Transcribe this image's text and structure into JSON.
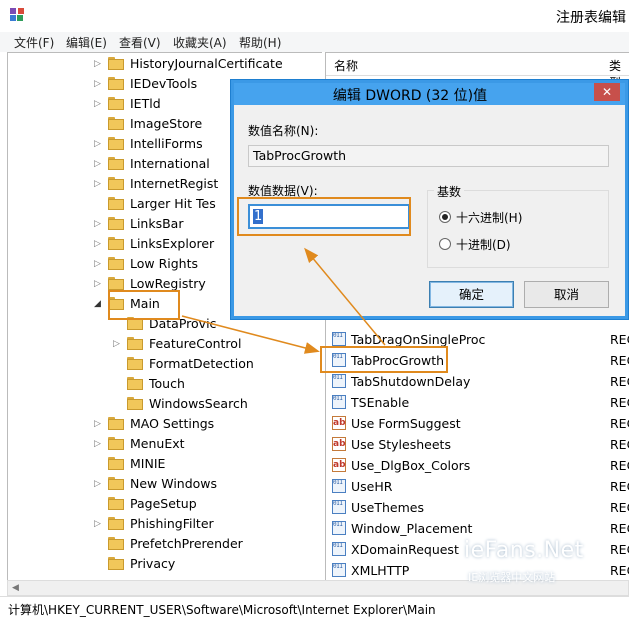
{
  "window": {
    "title": "注册表编辑",
    "icon": "regedit-icon"
  },
  "menubar": {
    "items": [
      "文件(F)",
      "编辑(E)",
      "查看(V)",
      "收藏夹(A)",
      "帮助(H)"
    ]
  },
  "tree": {
    "items": [
      {
        "label": "HistoryJournalCertificate",
        "level": 1,
        "expander": "collapsed"
      },
      {
        "label": "IEDevTools",
        "level": 1,
        "expander": "collapsed"
      },
      {
        "label": "IETld",
        "level": 1,
        "expander": "collapsed"
      },
      {
        "label": "ImageStore",
        "level": 1,
        "expander": "none"
      },
      {
        "label": "IntelliForms",
        "level": 1,
        "expander": "collapsed"
      },
      {
        "label": "International",
        "level": 1,
        "expander": "collapsed"
      },
      {
        "label": "InternetRegist",
        "level": 1,
        "expander": "collapsed"
      },
      {
        "label": "Larger Hit Tes",
        "level": 1,
        "expander": "none"
      },
      {
        "label": "LinksBar",
        "level": 1,
        "expander": "collapsed"
      },
      {
        "label": "LinksExplorer",
        "level": 1,
        "expander": "collapsed"
      },
      {
        "label": "Low Rights",
        "level": 1,
        "expander": "collapsed"
      },
      {
        "label": "LowRegistry",
        "level": 1,
        "expander": "collapsed"
      },
      {
        "label": "Main",
        "level": 1,
        "expander": "expanded"
      },
      {
        "label": "DataProvic",
        "level": 2,
        "expander": "none"
      },
      {
        "label": "FeatureControl",
        "level": 2,
        "expander": "collapsed"
      },
      {
        "label": "FormatDetection",
        "level": 2,
        "expander": "none"
      },
      {
        "label": "Touch",
        "level": 2,
        "expander": "none"
      },
      {
        "label": "WindowsSearch",
        "level": 2,
        "expander": "none"
      },
      {
        "label": "MAO Settings",
        "level": 1,
        "expander": "collapsed"
      },
      {
        "label": "MenuExt",
        "level": 1,
        "expander": "collapsed"
      },
      {
        "label": "MINIE",
        "level": 1,
        "expander": "none"
      },
      {
        "label": "New Windows",
        "level": 1,
        "expander": "collapsed"
      },
      {
        "label": "PageSetup",
        "level": 1,
        "expander": "none"
      },
      {
        "label": "PhishingFilter",
        "level": 1,
        "expander": "collapsed"
      },
      {
        "label": "PrefetchPrerender",
        "level": 1,
        "expander": "none"
      },
      {
        "label": "Privacy",
        "level": 1,
        "expander": "none"
      }
    ]
  },
  "list": {
    "headers": {
      "name": "名称",
      "type": "类型"
    },
    "rows": [
      {
        "name": "TabDragOnSingleProc",
        "icon": "binary-value-icon",
        "type": "REC"
      },
      {
        "name": "TabProcGrowth",
        "icon": "binary-value-icon",
        "type": "REC"
      },
      {
        "name": "TabShutdownDelay",
        "icon": "binary-value-icon",
        "type": "REC"
      },
      {
        "name": "TSEnable",
        "icon": "binary-value-icon",
        "type": "REC"
      },
      {
        "name": "Use FormSuggest",
        "icon": "string-value-icon",
        "type": "REC"
      },
      {
        "name": "Use Stylesheets",
        "icon": "string-value-icon",
        "type": "REC"
      },
      {
        "name": "Use_DlgBox_Colors",
        "icon": "string-value-icon",
        "type": "REC"
      },
      {
        "name": "UseHR",
        "icon": "binary-value-icon",
        "type": "REC"
      },
      {
        "name": "UseThemes",
        "icon": "binary-value-icon",
        "type": "REC"
      },
      {
        "name": "Window_Placement",
        "icon": "binary-value-icon",
        "type": "REC"
      },
      {
        "name": "XDomainRequest",
        "icon": "binary-value-icon",
        "type": "REC"
      },
      {
        "name": "XMLHTTP",
        "icon": "binary-value-icon",
        "type": "REC"
      }
    ]
  },
  "statusbar": {
    "path": "计算机\\HKEY_CURRENT_USER\\Software\\Microsoft\\Internet Explorer\\Main"
  },
  "dialog": {
    "title": "编辑 DWORD (32 位)值",
    "close_symbol": "✕",
    "name_label": "数值名称(N):",
    "name_value": "TabProcGrowth",
    "data_label": "数值数据(V):",
    "data_value": "1",
    "base_label": "基数",
    "base_options": [
      "十六进制(H)",
      "十进制(D)"
    ],
    "base_selected": "十六进制(H)",
    "ok_label": "确定",
    "cancel_label": "取消"
  },
  "watermark": {
    "brand": "ieFans.Net",
    "sub": "IE浏览器中文网站"
  },
  "colors": {
    "highlight_orange": "#e08a1e",
    "dialog_title_blue": "#46a3ee",
    "close_red": "#c7504b"
  }
}
